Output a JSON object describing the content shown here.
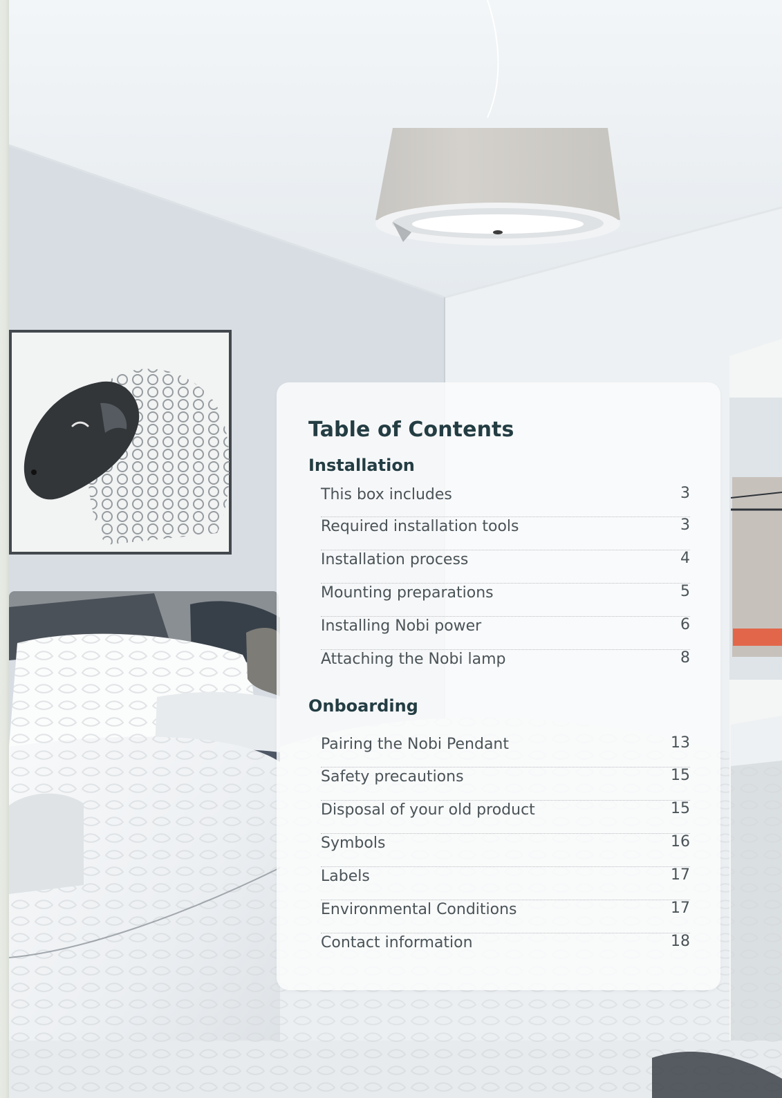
{
  "toc": {
    "title": "Table of Contents",
    "sections": [
      {
        "title": "Installation",
        "items": [
          {
            "label": "This box includes",
            "page": "3"
          },
          {
            "label": "Required installation tools",
            "page": "3"
          },
          {
            "label": "Installation process",
            "page": "4"
          },
          {
            "label": "Mounting preparations",
            "page": "5"
          },
          {
            "label": "Installing Nobi power",
            "page": "6"
          },
          {
            "label": "Attaching the Nobi lamp",
            "page": "8"
          }
        ]
      },
      {
        "title": "Onboarding",
        "items": [
          {
            "label": "Pairing the Nobi Pendant",
            "page": "13"
          },
          {
            "label": "Safety precautions",
            "page": "15"
          },
          {
            "label": "Disposal of your old product",
            "page": "15"
          },
          {
            "label": "Symbols",
            "page": "16"
          },
          {
            "label": "Labels",
            "page": "17"
          },
          {
            "label": "Environmental Conditions",
            "page": "17"
          },
          {
            "label": "Contact information",
            "page": "18"
          }
        ]
      }
    ]
  },
  "colors": {
    "heading": "#233d43",
    "text": "#4a5357",
    "card": "#fafbfc",
    "margin": "#e6e9e1"
  },
  "background_image": {
    "type": "photo",
    "subject": "bedroom with white pendant lamp, sheep painting and white bedding"
  }
}
